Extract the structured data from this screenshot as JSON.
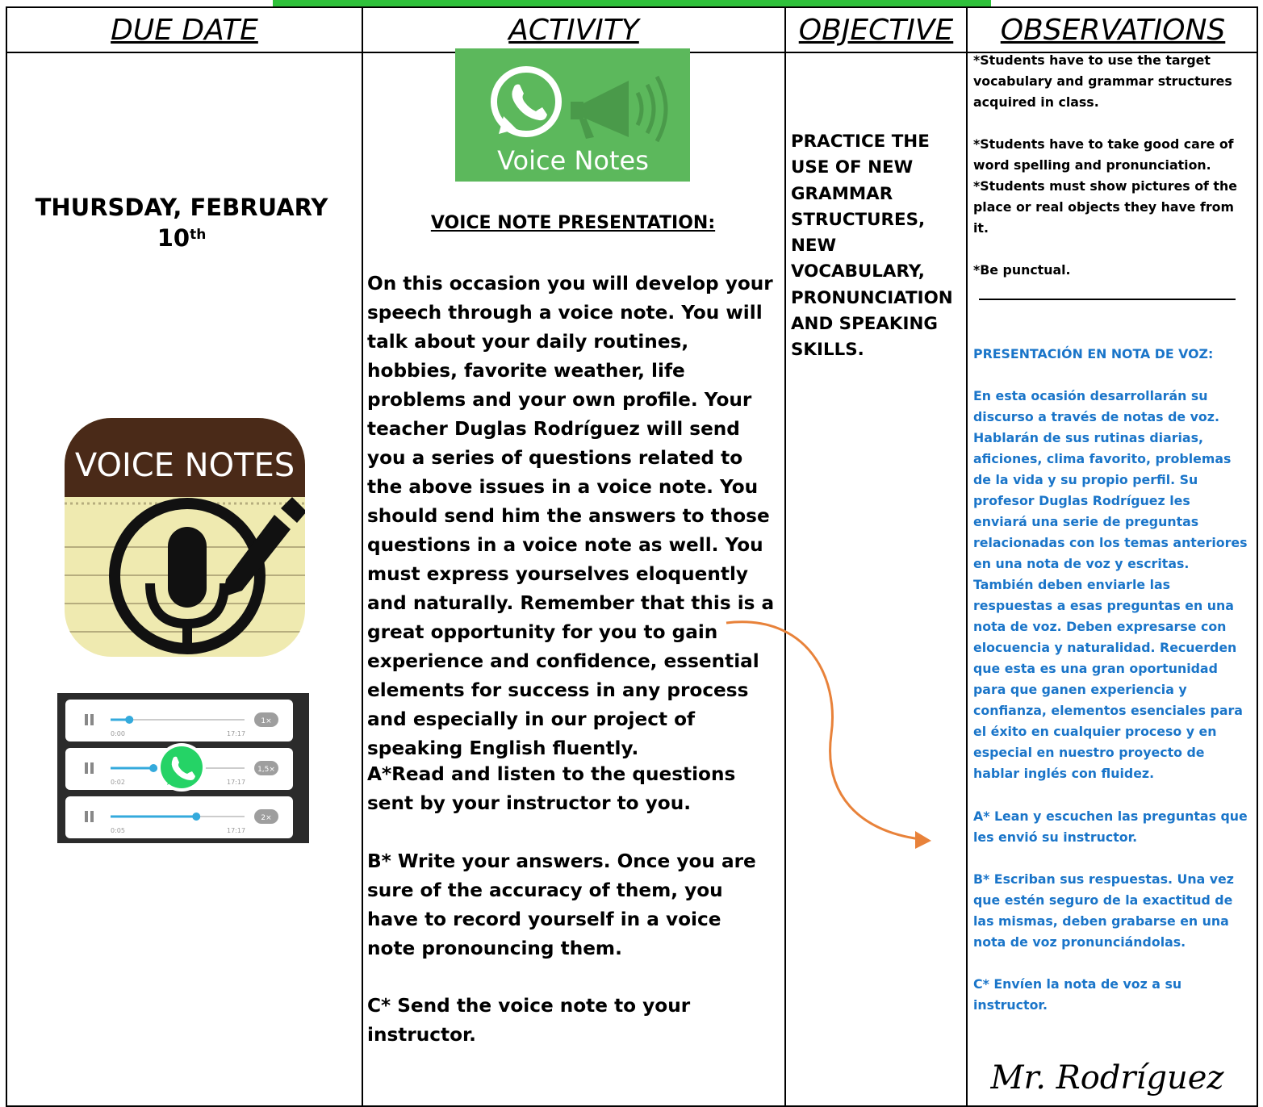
{
  "headers": {
    "due_date": "DUE DATE",
    "activity": "ACTIVITY",
    "objective": "OBJECTIVE",
    "observations": "OBSERVATIONS"
  },
  "due_date": {
    "line1": "THURSDAY, FEBRUARY",
    "day": "10",
    "suffix": "th"
  },
  "images": {
    "voice_notes_banner": "Voice Notes",
    "voice_notes_app": "VOICE NOTES",
    "player_rows": [
      {
        "start": "0:00",
        "end": "17:17",
        "speed": "1×",
        "progress": 0.14
      },
      {
        "start": "0:02",
        "end": "17:17",
        "speed": "1,5×",
        "progress": 0.32
      },
      {
        "start": "0:05",
        "end": "17:17",
        "speed": "2×",
        "progress": 0.64
      }
    ]
  },
  "activity": {
    "title": "VOICE NOTE PRESENTATION:",
    "paragraph": "On this occasion you will develop your speech through a voice note. You will talk about your daily routines, hobbies, favorite weather, life problems and your own profile. Your teacher Duglas Rodríguez will send you a series of questions related to the above issues in a voice note. You should send him the answers to those questions in a voice note as well. You must express yourselves eloquently and naturally. Remember that this is a great opportunity for you to gain experience and confidence, essential elements for success in any process and especially in our project of speaking English fluently.",
    "step_a": "A*Read and listen to the questions sent by your instructor to you.",
    "step_b": "B* Write your answers. Once you are sure of the accuracy of them, you have to record yourself in a voice note pronouncing them.",
    "step_c": "C* Send the voice note to your instructor."
  },
  "objective": "PRACTICE THE USE OF NEW GRAMMAR STRUCTURES, NEW VOCABULARY, PRONUNCIATION AND SPEAKING SKILLS.",
  "observations": {
    "note1": "*Students have to use the target vocabulary and grammar structures acquired in class.",
    "note2": "*Students have to take good care of word spelling and pronunciation.",
    "note3": "*Students must show pictures of the place or real objects they have from it.",
    "note4": "*Be punctual.",
    "es_title": "PRESENTACIÓN EN NOTA DE VOZ:",
    "es_paragraph": "En esta ocasión desarrollarán su discurso a través de notas de voz. Hablarán de sus rutinas diarias, aficiones, clima favorito, problemas de la vida y su propio perfil. Su profesor Duglas Rodríguez les enviará una serie de preguntas relacionadas con los temas anteriores en una nota de voz y escritas. También deben enviarle las respuestas a esas preguntas en una nota de voz. Deben expresarse con elocuencia y naturalidad. Recuerden que esta es una gran oportunidad para que ganen experiencia y confianza, elementos esenciales para el éxito en cualquier proceso y en especial en nuestro proyecto de hablar inglés con fluidez.",
    "es_a": "A* Lean y escuchen las preguntas que les envió su instructor.",
    "es_b": "B* Escriban sus respuestas. Una vez que estén seguro de la exactitud de las mismas, deben grabarse en una nota de voz pronunciándolas.",
    "es_c": "C* Envíen la nota de voz a su instructor.",
    "signature": "Mr. Rodríguez"
  },
  "colors": {
    "green_bar": "#2fc13b",
    "spanish_text": "#1a75c9",
    "arrow": "#e8823a"
  }
}
